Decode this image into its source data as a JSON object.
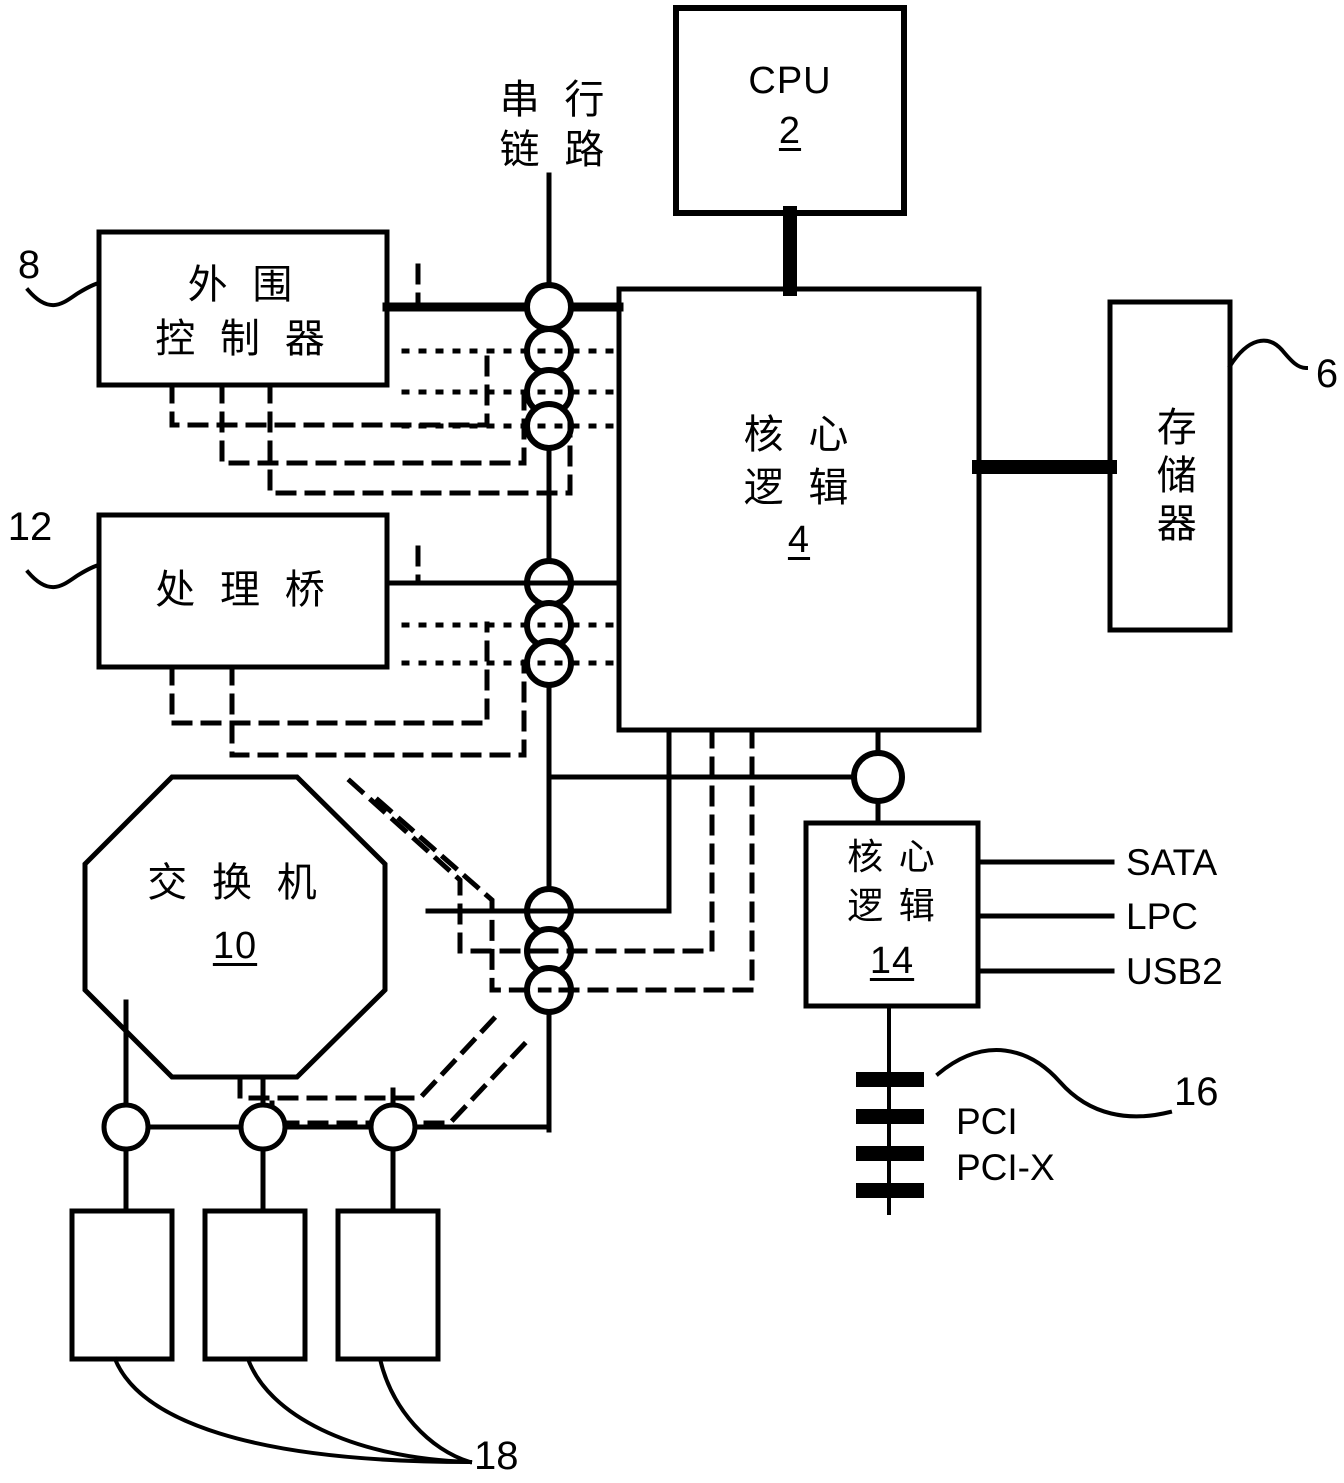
{
  "figure": {
    "kind": "patent-block-diagram",
    "ink_color": "#000000",
    "background": "#ffffff"
  },
  "blocks": {
    "cpu": {
      "title": "CPU",
      "ref": "2"
    },
    "peripheral": {
      "line1": "外 围",
      "line2": "控 制 器",
      "ref": "8"
    },
    "core_logic": {
      "line1": "核 心",
      "line2": "逻 辑",
      "ref": "4"
    },
    "memory": {
      "title": "存储器",
      "ref": "6"
    },
    "bridge": {
      "title": "处 理 桥",
      "ref": "12"
    },
    "switch": {
      "title": "交 换 机",
      "ref": "10"
    },
    "south": {
      "line1": "核 心",
      "line2": "逻 辑",
      "ref": "14"
    },
    "devices": {
      "ref": "18",
      "count": 3
    },
    "pci_slots": {
      "line1": "PCI",
      "line2": "PCI-X",
      "ref": "16",
      "count": 4
    }
  },
  "labels": {
    "serial_link_l1": "串 行",
    "serial_link_l2": "链 路"
  },
  "io_ports": [
    {
      "name": "SATA"
    },
    {
      "name": "LPC"
    },
    {
      "name": "USB2"
    }
  ],
  "reference_numerals": {
    "n2": "2",
    "n4": "4",
    "n6": "6",
    "n8": "8",
    "n10": "10",
    "n12": "12",
    "n14": "14",
    "n16": "16",
    "n18": "18"
  }
}
